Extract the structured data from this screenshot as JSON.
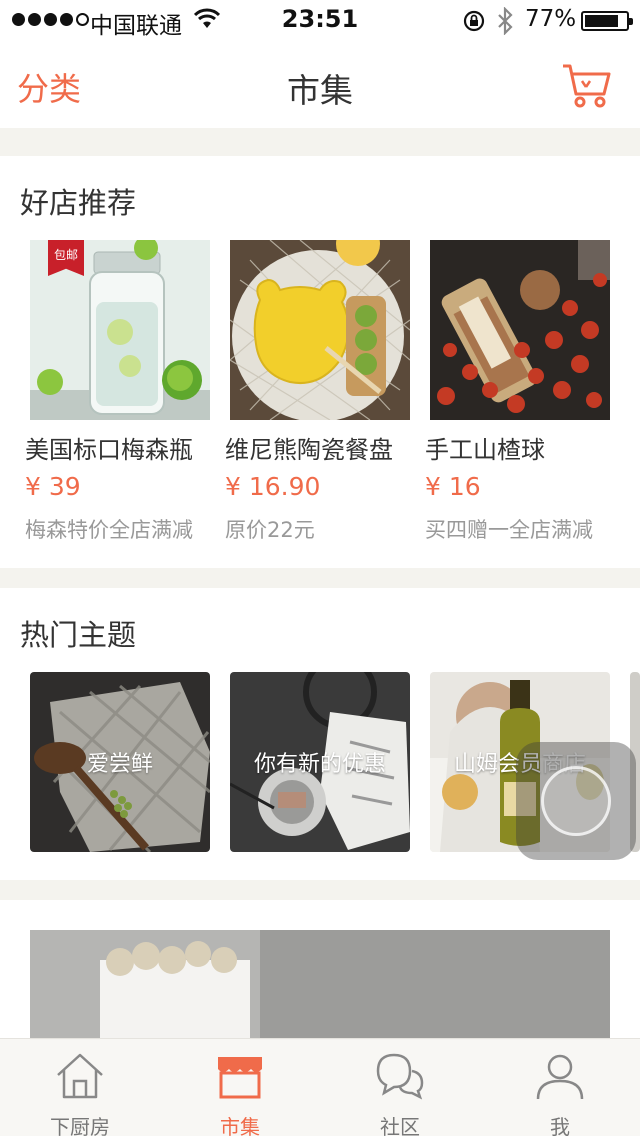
{
  "status_bar": {
    "carrier": "中国联通",
    "time": "23:51",
    "battery": "77%"
  },
  "nav": {
    "left": "分类",
    "title": "市集"
  },
  "recommend": {
    "title": "好店推荐",
    "items": [
      {
        "name": "美国标口梅森瓶",
        "price": "¥ 39",
        "sub": "梅森特价全店满减",
        "badge": "包邮"
      },
      {
        "name": "维尼熊陶瓷餐盘",
        "price": "¥ 16.90",
        "sub": "原价22元"
      },
      {
        "name": "手工山楂球",
        "price": "¥ 16",
        "sub": "买四赠一全店满减"
      }
    ]
  },
  "themes": {
    "title": "热门主题",
    "items": [
      {
        "label": "爱尝鲜"
      },
      {
        "label": "你有新的优惠"
      },
      {
        "label": "山姆会员商店"
      }
    ]
  },
  "tabs": [
    {
      "label": "下厨房"
    },
    {
      "label": "市集"
    },
    {
      "label": "社区"
    },
    {
      "label": "我"
    }
  ],
  "colors": {
    "accent": "#f06b4a",
    "badge": "#c8202a"
  }
}
